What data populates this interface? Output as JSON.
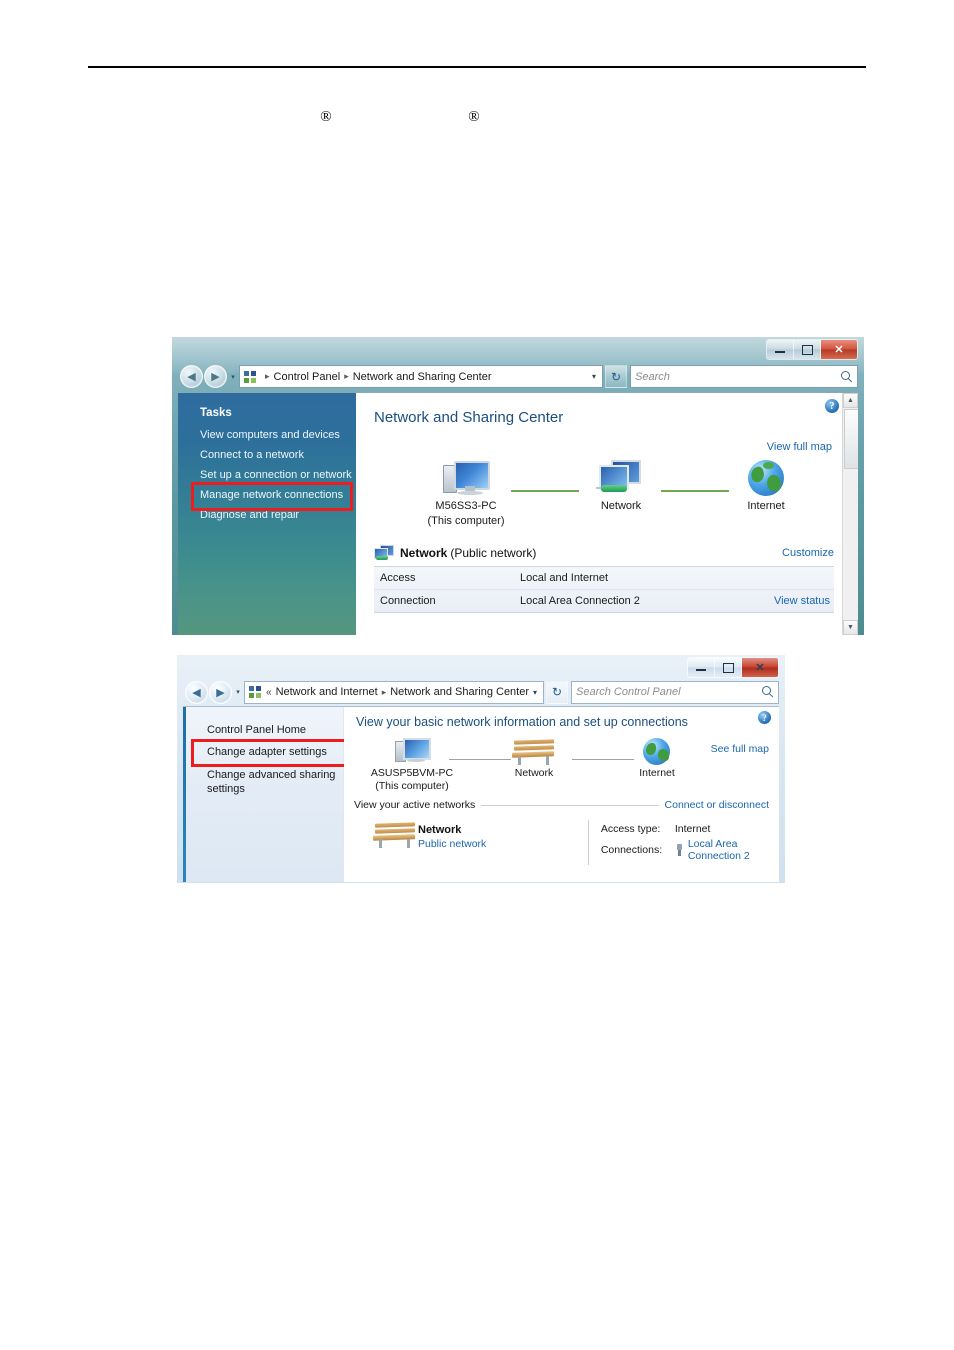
{
  "page": {
    "registered_mark_1": "®",
    "registered_mark_2": "®"
  },
  "window_vista": {
    "title_buttons": {
      "minimize": "–",
      "maximize": "□",
      "close": "✕"
    },
    "nav": {
      "back_icon": "◀",
      "forward_icon": "▶",
      "history_caret": "▾"
    },
    "address": {
      "icon_name": "control-panel-icon",
      "leading_separator": "▸",
      "crumbs": [
        "Control Panel",
        "Network and Sharing Center"
      ],
      "separator": "▸",
      "dropdown_caret": "▾",
      "refresh_icon": "↻"
    },
    "search": {
      "placeholder": "Search",
      "icon_name": "search-icon"
    },
    "sidebar": {
      "title": "Tasks",
      "items": [
        {
          "label": "View computers and devices",
          "highlighted": false
        },
        {
          "label": "Connect to a network",
          "highlighted": false
        },
        {
          "label": "Set up a connection or network",
          "highlighted": false
        },
        {
          "label": "Manage network connections",
          "highlighted": true
        },
        {
          "label": "Diagnose and repair",
          "highlighted": false
        }
      ],
      "highlight_color": "#ee1c1c"
    },
    "main": {
      "heading": "Network and Sharing Center",
      "help_glyph": "?",
      "view_full_map": "View full map",
      "diagram": {
        "nodes": [
          {
            "icon": "computer-icon",
            "line1": "M56SS3-PC",
            "line2": "(This computer)"
          },
          {
            "icon": "network-icon",
            "line1": "Network",
            "line2": ""
          },
          {
            "icon": "globe-icon",
            "line1": "Internet",
            "line2": ""
          }
        ],
        "link_color": "#6fa84f"
      },
      "network_block": {
        "icon_name": "network-icon",
        "name": "Network",
        "kind": "(Public network)",
        "customize_link": "Customize",
        "rows": [
          {
            "key": "Access",
            "value": "Local and Internet",
            "action": ""
          },
          {
            "key": "Connection",
            "value": "Local Area Connection 2",
            "action": "View status"
          }
        ]
      },
      "scrollbar": {
        "up_arrow": "▲",
        "down_arrow": "▼"
      }
    }
  },
  "window_win7": {
    "title_buttons": {
      "minimize": "–",
      "maximize": "□",
      "close": "✕"
    },
    "nav": {
      "back_icon": "◀",
      "forward_icon": "▶",
      "history_caret": "▾"
    },
    "address": {
      "icon_name": "control-panel-icon",
      "overflow_chevron": "«",
      "crumbs": [
        "Network and Internet",
        "Network and Sharing Center"
      ],
      "separator": "▸",
      "dropdown_caret": "▾",
      "refresh_icon": "↻"
    },
    "search": {
      "placeholder": "Search Control Panel",
      "icon_name": "search-icon"
    },
    "sidebar": {
      "items": [
        {
          "label": "Control Panel Home",
          "highlighted": false
        },
        {
          "label": "Change adapter settings",
          "highlighted": true
        },
        {
          "label": "Change advanced sharing settings",
          "highlighted": false
        }
      ],
      "highlight_color": "#ee1c1c"
    },
    "main": {
      "heading": "View your basic network information and set up connections",
      "help_glyph": "?",
      "see_full_map": "See full map",
      "diagram": {
        "nodes": [
          {
            "icon": "computer-icon",
            "line1": "ASUSP5BVM-PC",
            "line2": "(This computer)"
          },
          {
            "icon": "bench-icon",
            "line1": "Network",
            "line2": ""
          },
          {
            "icon": "globe-icon",
            "line1": "Internet",
            "line2": ""
          }
        ]
      },
      "active_networks": {
        "label": "View your active networks",
        "action": "Connect or disconnect"
      },
      "network_entry": {
        "icon_name": "bench-icon",
        "name": "Network",
        "type_link": "Public network",
        "details": [
          {
            "key": "Access type:",
            "value": "Internet",
            "is_link": false,
            "icon": ""
          },
          {
            "key": "Connections:",
            "value": "Local Area Connection 2",
            "is_link": true,
            "icon": "lan-adapter-icon"
          }
        ]
      }
    }
  }
}
